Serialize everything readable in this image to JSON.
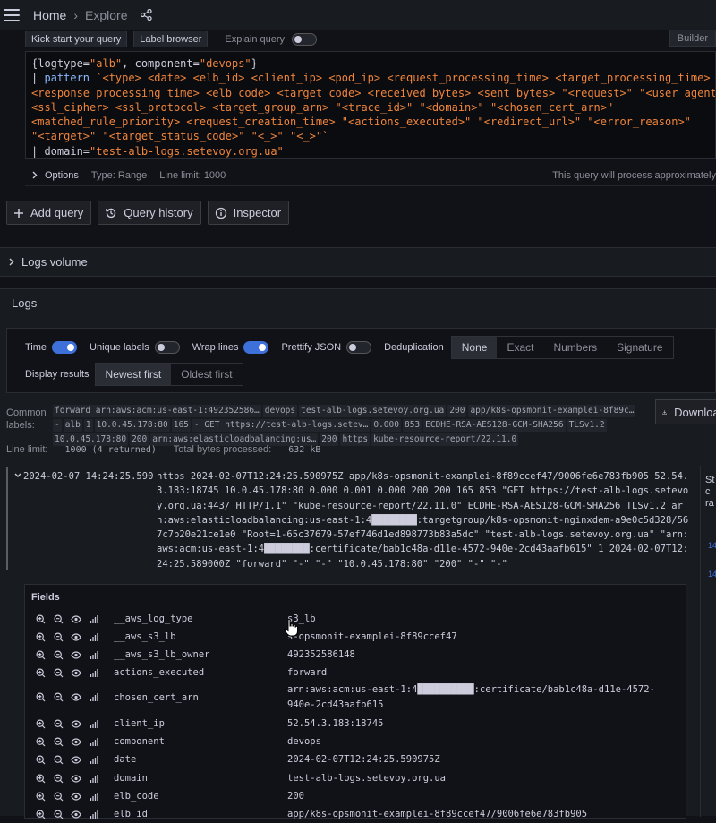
{
  "header": {
    "home": "Home",
    "sep": "›",
    "explore": "Explore"
  },
  "query_toolbar": {
    "kick_start": "Kick start your query",
    "label_browser": "Label browser",
    "explain": "Explain query",
    "builder": "Builder"
  },
  "query": {
    "line1_a": "{logtype=",
    "line1_b": "\"alb\"",
    "line1_c": ", component=",
    "line1_d": "\"devops\"",
    "line1_e": "}",
    "line2_pipe": "| ",
    "line2_kw": "pattern ",
    "line2_rest": "`<type> <date> <elb_id> <client_ip> <pod_ip> <request_processing_time> <target_processing_time>",
    "line3": "<response_processing_time> <elb_code> <target_code> <received_bytes> <sent_bytes> \"<request>\" \"<user_agent>\"",
    "line4": "<ssl_cipher> <ssl_protocol> <target_group_arn> \"<trace_id>\" \"<domain>\" \"<chosen_cert_arn>\"",
    "line5": "<matched_rule_priority> <request_creation_time> \"<actions_executed>\" \"<redirect_url>\" \"<error_reason>\"",
    "line6": "\"<target>\" \"<target_status_code>\" \"<_>\" \"<_>\"`",
    "line7_pipe": "| ",
    "line7_a": "domain=",
    "line7_b": "\"test-alb-logs.setevoy.org.ua\""
  },
  "options_row": {
    "title": "Options",
    "type": "Type: Range",
    "limit": "Line limit: 1000",
    "note": "This query will process approximately"
  },
  "actions": {
    "add_query": "Add query",
    "history": "Query history",
    "inspector": "Inspector"
  },
  "logs_volume": {
    "title": "Logs volume"
  },
  "logs": {
    "title": "Logs",
    "time": "Time",
    "unique_labels": "Unique labels",
    "wrap_lines": "Wrap lines",
    "prettify": "Prettify JSON",
    "dedup": "Deduplication",
    "dedup_options": [
      "None",
      "Exact",
      "Numbers",
      "Signature"
    ],
    "display_results": "Display results",
    "order_options": [
      "Newest first",
      "Oldest first"
    ],
    "download": "Download",
    "common_label": "Common labels:",
    "chips": [
      "forward arn:aws:acm:us-east-1:492352586…",
      "devops",
      "test-alb-logs.setevoy.org.ua",
      "200",
      "app/k8s-opsmonit-examplei-8f89c…",
      "-",
      "alb",
      "1",
      "10.0.45.178:80",
      "165",
      "- GET https://test-alb-logs.setev…",
      "0.000",
      "853",
      "ECDHE-RSA-AES128-GCM-SHA256",
      "TLSv1.2",
      "10.0.45.178:80",
      "200",
      "arn:aws:elasticloadbalancing:us…",
      "200",
      "https",
      "kube-resource-report/22.11.0"
    ],
    "stats_limit_label": "Line limit:",
    "stats_limit": "1000 (4 returned)",
    "stats_bytes_label": "Total bytes processed:",
    "stats_bytes": "632 kB"
  },
  "log_row": {
    "timestamp": "2024-02-07 14:24:25.590",
    "message": "https 2024-02-07T12:24:25.590975Z app/k8s-opsmonit-examplei-8f89ccef47/9006fe6e783fb905 52.54.3.183:18745 10.0.45.178:80 0.000 0.001 0.000 200 200 165 853 \"GET https://test-alb-logs.setevoy.org.ua:443/ HTTP/1.1\" \"kube-resource-report/22.11.0\" ECDHE-RSA-AES128-GCM-SHA256 TLSv1.2 arn:aws:elasticloadbalancing:us-east-1:4████████:targetgroup/k8s-opsmonit-nginxdem-a9e0c5d328/567c7b20e21ce1e0 \"Root=1-65c37679-57ef746d1ed898773b83a5dc\" \"test-alb-logs.setevoy.org.ua\" \"arn:aws:acm:us-east-1:4████████:certificate/bab1c48a-d11e-4572-940e-2cd43aafb615\" 1 2024-02-07T12:24:25.589000Z \"forward\" \"-\" \"-\" \"10.0.45.178:80\" \"200\" \"-\" \"-\""
  },
  "side": {
    "t1": "St",
    "t2": "c",
    "t3": "ra",
    "n1": "14",
    "n2": "14"
  },
  "fields": {
    "title": "Fields",
    "rows": [
      {
        "name": "__aws_log_type",
        "value": "s3_lb"
      },
      {
        "name": "__aws_s3_lb",
        "value": "s-opsmonit-examplei-8f89ccef47"
      },
      {
        "name": "__aws_s3_lb_owner",
        "value": "492352586148"
      },
      {
        "name": "actions_executed",
        "value": "forward"
      },
      {
        "name": "chosen_cert_arn",
        "value": "arn:aws:acm:us-east-1:4██████████:certificate/bab1c48a-d11e-4572-940e-2cd43aafb615"
      },
      {
        "name": "client_ip",
        "value": "52.54.3.183:18745"
      },
      {
        "name": "component",
        "value": "devops"
      },
      {
        "name": "date",
        "value": "2024-02-07T12:24:25.590975Z"
      },
      {
        "name": "domain",
        "value": "test-alb-logs.setevoy.org.ua"
      },
      {
        "name": "elb_code",
        "value": "200"
      },
      {
        "name": "elb_id",
        "value": "app/k8s-opsmonit-examplei-8f89ccef47/9006fe6e783fb905"
      }
    ]
  }
}
